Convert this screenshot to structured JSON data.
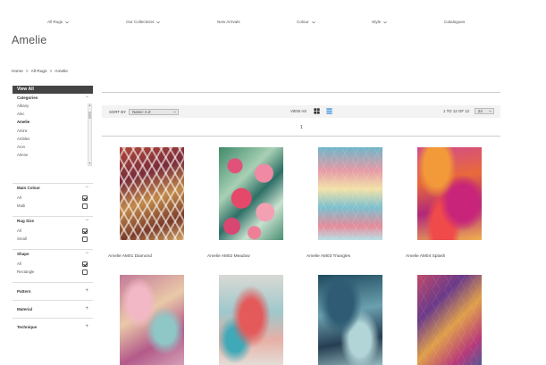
{
  "nav": {
    "items": [
      {
        "label": "All Rugs",
        "has_dropdown": true
      },
      {
        "label": "Our Collections",
        "has_dropdown": true
      },
      {
        "label": "New Arrivals",
        "has_dropdown": false
      },
      {
        "label": "Colour",
        "has_dropdown": true
      },
      {
        "label": "Style",
        "has_dropdown": true
      },
      {
        "label": "Catalogues",
        "has_dropdown": false
      }
    ]
  },
  "page_title": "Amelie",
  "breadcrumb": {
    "home": "Home",
    "sep1": ">",
    "all_rugs": "All Rugs",
    "sep2": ">",
    "current": "Amelie"
  },
  "sidebar": {
    "view_all": "View All",
    "categories": {
      "title": "Categories",
      "toggle": "−",
      "items": [
        "Albany",
        "Alec",
        "Amelie",
        "Amira",
        "Ambles",
        "Aron",
        "Arlene"
      ],
      "active": "Amelie"
    },
    "main_colour": {
      "title": "Main Colour",
      "toggle": "−",
      "options": [
        {
          "label": "All",
          "checked": true
        },
        {
          "label": "Multi",
          "checked": false
        }
      ]
    },
    "rug_size": {
      "title": "Rug Size",
      "toggle": "−",
      "options": [
        {
          "label": "All",
          "checked": true
        },
        {
          "label": "Small",
          "checked": false
        }
      ]
    },
    "shape": {
      "title": "Shape",
      "toggle": "−",
      "options": [
        {
          "label": "All",
          "checked": true
        },
        {
          "label": "Rectangle",
          "checked": false
        }
      ]
    },
    "pattern": {
      "title": "Pattern",
      "toggle": "+"
    },
    "material": {
      "title": "Material",
      "toggle": "+"
    },
    "technique": {
      "title": "Technique",
      "toggle": "+"
    }
  },
  "toolbar": {
    "sort_label": "SORT BY",
    "sort_value": "Name: A-Z",
    "view_as_label": "VIEW AS",
    "range_text": "1 TO 12 OF 12",
    "per_page": "24"
  },
  "pagination": {
    "current": "1"
  },
  "products": [
    {
      "name": "Amelie AM01 Diamond"
    },
    {
      "name": "Amelie AM02 Meadow"
    },
    {
      "name": "Amelie AM03 Triangles"
    },
    {
      "name": "Amelie AM04 Splash"
    },
    {
      "name": ""
    },
    {
      "name": ""
    },
    {
      "name": ""
    },
    {
      "name": ""
    }
  ],
  "colors": {
    "view_all_bg": "#444444",
    "toolbar_bg": "#f3f3f3",
    "list_icon_active": "#3a8fd6"
  }
}
